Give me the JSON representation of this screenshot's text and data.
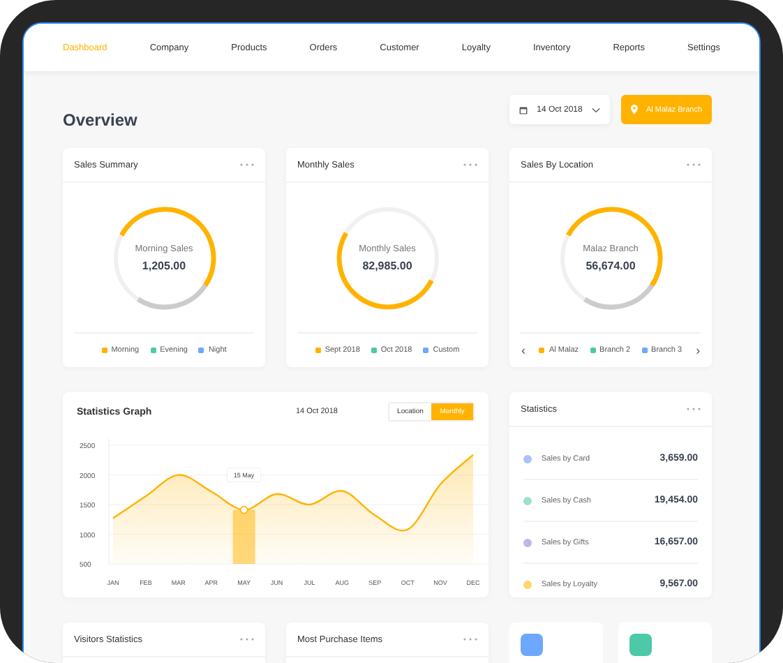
{
  "nav": [
    {
      "label": "Dashboard",
      "selected": true
    },
    {
      "label": "Company",
      "selected": false
    },
    {
      "label": "Products",
      "selected": false
    },
    {
      "label": "Orders",
      "selected": false
    },
    {
      "label": "Customer",
      "selected": false
    },
    {
      "label": "Loyalty",
      "selected": false
    },
    {
      "label": "Inventory",
      "selected": false
    },
    {
      "label": "Reports",
      "selected": false
    },
    {
      "label": "Settings",
      "selected": false
    }
  ],
  "header": {
    "title": "Overview",
    "date": "14 Oct 2018",
    "branch": "Al Malaz Branch"
  },
  "gauges": [
    {
      "title": "Sales Summary",
      "kind": "split",
      "label": "Morning Sales",
      "value": "1,205.00",
      "legend": [
        {
          "label": "Morning",
          "color": "#ffb300"
        },
        {
          "label": "Evening",
          "color": "#4cc9a6"
        },
        {
          "label": "Night",
          "color": "#6ea8fe"
        }
      ]
    },
    {
      "title": "Monthly Sales",
      "kind": "single",
      "label": "Monthly Sales",
      "value": "82,985.00",
      "legend": [
        {
          "label": "Sept 2018",
          "color": "#ffb300"
        },
        {
          "label": "Oct 2018",
          "color": "#4cc9a6"
        },
        {
          "label": "Custom",
          "color": "#6ea8fe"
        }
      ]
    },
    {
      "title": "Sales By Location",
      "kind": "split",
      "label": "Malaz Branch",
      "value": "56,674.00",
      "legend": [
        {
          "label": "Al Malaz",
          "color": "#ffb300"
        },
        {
          "label": "Branch 2",
          "color": "#4cc9a6"
        },
        {
          "label": "Branch 3",
          "color": "#6ea8fe"
        }
      ],
      "pager": true,
      "prev": "‹",
      "next": "›"
    }
  ],
  "graph": {
    "title": "Statistics Graph",
    "date": "14 Oct 2018",
    "toggle": [
      {
        "label": "Location",
        "selected": false
      },
      {
        "label": "Monthly",
        "selected": true
      }
    ],
    "chart_data": {
      "type": "area",
      "categories": [
        "JAN",
        "FEB",
        "MAR",
        "APR",
        "MAY",
        "JUN",
        "JUL",
        "AUG",
        "SEP",
        "OCT",
        "NOV",
        "DEC"
      ],
      "series": [
        {
          "color": "#ffb300",
          "values": [
            1270,
            1640,
            2000,
            1720,
            1410,
            1680,
            1500,
            1730,
            1320,
            1080,
            1840,
            2340
          ]
        }
      ],
      "ylim": [
        500,
        2500
      ],
      "yticks": [
        500,
        1000,
        1500,
        2000,
        2500
      ],
      "grid": true,
      "annotations": [
        {
          "x": "MAY",
          "text": "15 May"
        }
      ]
    }
  },
  "statistics": {
    "title": "Statistics",
    "rows": [
      {
        "label": "Sales by Card",
        "value": "3,659.00",
        "color": "#a9c4f5"
      },
      {
        "label": "Sales by Cash",
        "value": "19,454.00",
        "color": "#9fe0cb"
      },
      {
        "label": "Sales by Gifts",
        "value": "16,657.00",
        "color": "#c2b5e8"
      },
      {
        "label": "Sales by Loyalty",
        "value": "9,567.00",
        "color": "#ffd66b"
      }
    ]
  },
  "bottom_cards": [
    {
      "title": "Visitors Statistics"
    },
    {
      "title": "Most Purchase Items"
    }
  ],
  "tiles": [
    {
      "color": "#6ea8fe"
    },
    {
      "color": "#4cc9a6"
    }
  ]
}
